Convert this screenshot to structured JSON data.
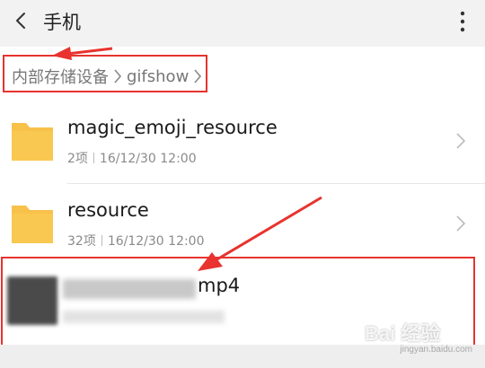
{
  "header": {
    "title": "手机",
    "back_icon": "back-arrow-icon",
    "more_icon": "more-vertical-icon"
  },
  "breadcrumb": {
    "items": [
      "内部存储设备",
      "gifshow"
    ],
    "separator_icon": "chevron-right-icon"
  },
  "files": [
    {
      "name": "magic_emoji_resource",
      "count": "2项",
      "date": "16/12/30 12:00",
      "icon": "folder-icon",
      "accent": "#f7c14a"
    },
    {
      "name": "resource",
      "count": "32项",
      "date": "16/12/30 12:00",
      "icon": "folder-icon",
      "accent": "#f7c14a"
    }
  ],
  "highlighted_file": {
    "name_visible": "mp4",
    "thumbnail": "video-thumbnail"
  },
  "annotation": {
    "color": "#e8332e"
  },
  "watermark": {
    "logo": "Bai 经验",
    "text": "jingyan.baidu.com"
  }
}
